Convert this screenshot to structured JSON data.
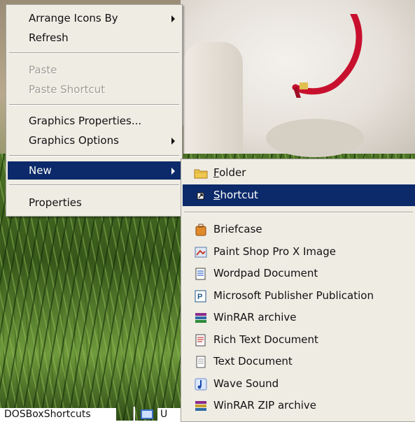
{
  "context_menu": {
    "items": [
      {
        "label": "Arrange Icons By",
        "submenu": true,
        "disabled": false
      },
      {
        "label": "Refresh",
        "submenu": false,
        "disabled": false
      },
      {
        "label": "Paste",
        "submenu": false,
        "disabled": true
      },
      {
        "label": "Paste Shortcut",
        "submenu": false,
        "disabled": true
      },
      {
        "label": "Graphics Properties...",
        "submenu": false,
        "disabled": false
      },
      {
        "label": "Graphics Options",
        "submenu": true,
        "disabled": false
      },
      {
        "label": "New",
        "submenu": true,
        "disabled": false,
        "highlighted": true
      },
      {
        "label": "Properties",
        "submenu": false,
        "disabled": false
      }
    ]
  },
  "new_submenu": {
    "folder": {
      "accel": "F",
      "rest": "older",
      "icon": "folder-icon"
    },
    "shortcut": {
      "accel": "S",
      "rest": "hortcut",
      "icon": "shortcut-icon",
      "highlighted": true
    },
    "items": [
      {
        "label": "Briefcase",
        "icon": "briefcase-icon"
      },
      {
        "label": "Paint Shop Pro X Image",
        "icon": "paint-shop-pro-icon"
      },
      {
        "label": "Wordpad Document",
        "icon": "wordpad-document-icon"
      },
      {
        "label": "Microsoft Publisher Publication",
        "icon": "publisher-icon"
      },
      {
        "label": "WinRAR archive",
        "icon": "winrar-icon"
      },
      {
        "label": "Rich Text Document",
        "icon": "rich-text-document-icon"
      },
      {
        "label": "Text Document",
        "icon": "text-document-icon"
      },
      {
        "label": "Wave Sound",
        "icon": "wave-sound-icon"
      },
      {
        "label": "WinRAR ZIP archive",
        "icon": "winrar-zip-icon"
      }
    ]
  },
  "desktop": {
    "icon_label": "DOSBoxShortcuts",
    "taskbar_button_text": "U"
  },
  "colors": {
    "menu_bg": "#efece4",
    "highlight": "#0c2a6a",
    "disabled_text": "#a09d93"
  }
}
